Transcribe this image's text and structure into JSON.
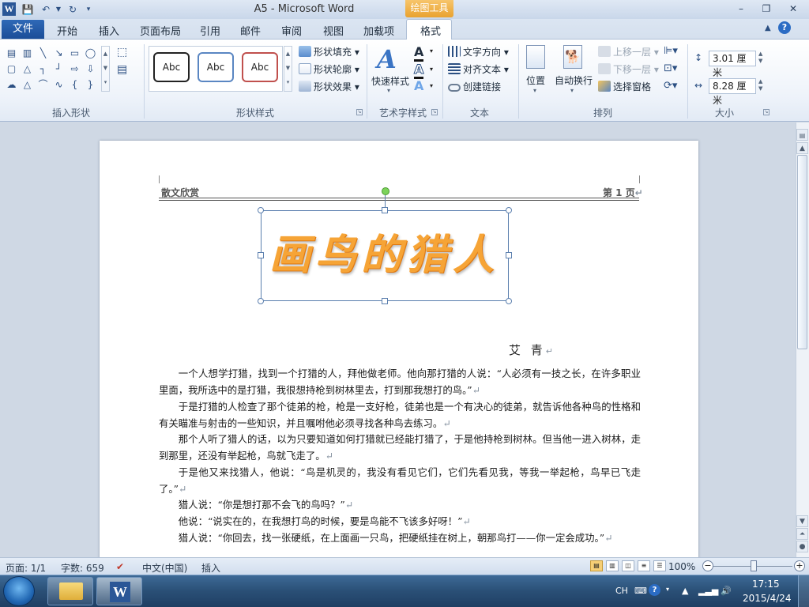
{
  "window": {
    "app_title": "A5 - Microsoft Word",
    "contextual_tab_group": "绘图工具",
    "app_icon_letter": "W"
  },
  "tabs": {
    "file": "文件",
    "items": [
      "开始",
      "插入",
      "页面布局",
      "引用",
      "邮件",
      "审阅",
      "视图",
      "加载项",
      "格式"
    ]
  },
  "ribbon": {
    "groups": {
      "insert_shapes": "插入形状",
      "shape_styles": "形状样式",
      "wordart_styles": "艺术字样式",
      "text": "文本",
      "arrange": "排列",
      "size": "大小"
    },
    "shape_style_sample": "Abc",
    "shape_fill": "形状填充",
    "shape_outline": "形状轮廓",
    "shape_effects": "形状效果",
    "quick_styles": "快速样式",
    "text_direction": "文字方向",
    "align_text": "对齐文本",
    "create_link": "创建链接",
    "position": "位置",
    "wrap_text": "自动换行",
    "bring_forward": "上移一层",
    "send_backward": "下移一层",
    "selection_pane": "选择窗格",
    "height": "3.01 厘米",
    "width": "8.28 厘米"
  },
  "document": {
    "header_left": "散文欣赏",
    "header_right": "第 1 页",
    "wordart_title": "画鸟的猎人",
    "author": "艾  青",
    "paragraphs": [
      "一个人想学打猎，找到一个打猎的人，拜他做老师。他向那打猎的人说：“人必须有一技之长，在许多职业里面，我所选中的是打猎，我很想持枪到树林里去，打到那我想打的鸟。”",
      "于是打猎的人检查了那个徒弟的枪，枪是一支好枪，徒弟也是一个有决心的徒弟，就告诉他各种鸟的性格和有关瞄准与射击的一些知识，并且嘱咐他必须寻找各种鸟去练习。",
      "那个人听了猎人的话，以为只要知道如何打猎就已经能打猎了，于是他持枪到树林。但当他一进入树林，走到那里，还没有举起枪，鸟就飞走了。",
      "于是他又来找猎人，他说：“鸟是机灵的，我没有看见它们，它们先看见我，等我一举起枪，鸟早已飞走了。”",
      "猎人说：“你是想打那不会飞的鸟吗？”",
      "他说：“说实在的，在我想打鸟的时候，要是鸟能不飞该多好呀！”",
      "猎人说：“你回去，找一张硬纸，在上面画一只鸟，把硬纸挂在树上，朝那鸟打——你一定会成功。”"
    ]
  },
  "statusbar": {
    "page": "页面: 1/1",
    "words": "字数: 659",
    "language": "中文(中国)",
    "mode": "插入",
    "zoom": "100%",
    "zoom_level": 100
  },
  "taskbar": {
    "lang": "CH",
    "time": "17:15",
    "date": "2015/4/24"
  },
  "colors": {
    "file_tab": "#1b4d98",
    "contextual_tab": "#e9a22f",
    "wordart": "#f6a436"
  }
}
